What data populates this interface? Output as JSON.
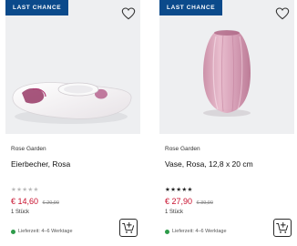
{
  "products": [
    {
      "badge": "LAST CHANCE",
      "brand": "Rose Garden",
      "title": "Eierbecher, Rosa",
      "rating_text": "★★★★★",
      "rating": 0,
      "price": "€ 14,60",
      "old_price": "€ 20,90",
      "unit": "1 Stück",
      "delivery": "Lieferzeit: 4–6 Werktage",
      "image_icon": "egg-cup-image",
      "colors": {
        "badge": "#0b4a8b",
        "price": "#c8102e",
        "delivery_dot": "#2e9b4a"
      }
    },
    {
      "badge": "LAST CHANCE",
      "brand": "Rose Garden",
      "title": "Vase, Rosa, 12,8 x 20 cm",
      "rating_text": "★★★★★",
      "rating": 5,
      "price": "€ 27,90",
      "old_price": "€ 39,90",
      "unit": "1 Stück",
      "delivery": "Lieferzeit: 4–6 Werktage",
      "image_icon": "vase-image",
      "colors": {
        "badge": "#0b4a8b",
        "price": "#c8102e",
        "delivery_dot": "#2e9b4a"
      }
    }
  ]
}
